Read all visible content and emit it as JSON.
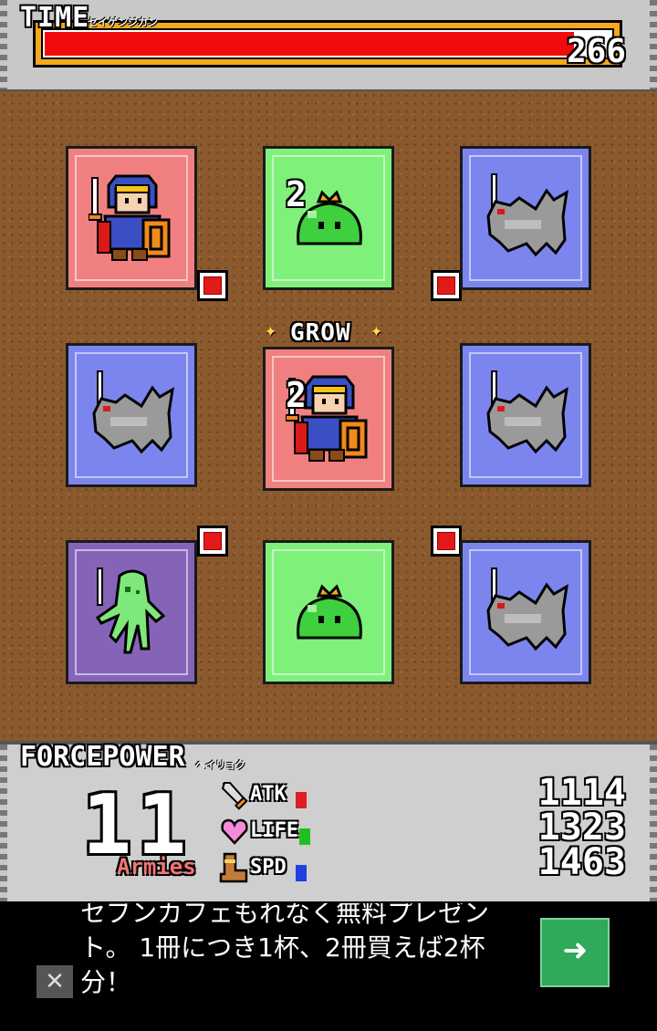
{
  "time": {
    "label": "TIME",
    "sub_label": "セイゲンジカン",
    "value": "266",
    "remaining_fraction": 0.93
  },
  "board": {
    "grow_badge": "GROW",
    "cards": [
      {
        "id": "r0c0",
        "color": "red",
        "unit": "hero-knight",
        "level": ""
      },
      {
        "id": "r0c1",
        "color": "green",
        "unit": "king-slime",
        "level": "2"
      },
      {
        "id": "r0c2",
        "color": "blue",
        "unit": "gray-wolf",
        "level": ""
      },
      {
        "id": "r1c0",
        "color": "blue",
        "unit": "gray-wolf",
        "level": ""
      },
      {
        "id": "r1c1",
        "color": "red",
        "unit": "hero-knight",
        "level": "2"
      },
      {
        "id": "r1c2",
        "color": "blue",
        "unit": "gray-wolf",
        "level": ""
      },
      {
        "id": "r2c0",
        "color": "purple",
        "unit": "green-ghost",
        "level": ""
      },
      {
        "id": "r2c1",
        "color": "green",
        "unit": "king-slime",
        "level": ""
      },
      {
        "id": "r2c2",
        "color": "blue",
        "unit": "gray-wolf",
        "level": ""
      }
    ]
  },
  "force": {
    "label": "FORCEPOWER",
    "sub_label": "ヘイリョク",
    "armies_count": "11",
    "armies_label": "Armies",
    "stats": [
      {
        "label": "ATK",
        "icon": "sword-icon",
        "color": "#e02020",
        "value": "1114"
      },
      {
        "label": "LIFE",
        "icon": "heart-icon",
        "color": "#20c020",
        "value": "1323"
      },
      {
        "label": "SPD",
        "icon": "boot-icon",
        "color": "#2040e0",
        "value": "1463"
      }
    ]
  },
  "ad": {
    "text": "セブンカフェもれなく無料プレゼント。 1冊につき1杯、2冊買えば2杯分！",
    "go_icon": "arrow-right-icon",
    "close_icon": "close-icon"
  }
}
